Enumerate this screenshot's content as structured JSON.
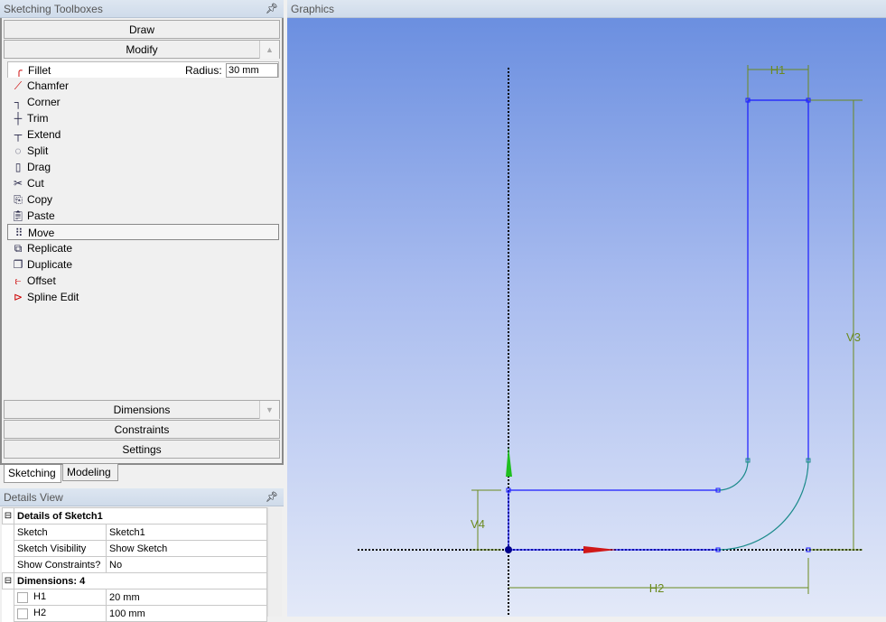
{
  "toolbox": {
    "title": "Sketching Toolboxes",
    "pin_icon": "pin-icon",
    "groups": {
      "draw": "Draw",
      "modify": "Modify",
      "dimensions": "Dimensions",
      "constraints": "Constraints",
      "settings": "Settings"
    },
    "radius_label": "Radius:",
    "radius_value": "30 mm",
    "tools": [
      {
        "label": "Fillet",
        "icon": "fillet-icon"
      },
      {
        "label": "Chamfer",
        "icon": "chamfer-icon"
      },
      {
        "label": "Corner",
        "icon": "corner-icon"
      },
      {
        "label": "Trim",
        "icon": "trim-icon"
      },
      {
        "label": "Extend",
        "icon": "extend-icon"
      },
      {
        "label": "Split",
        "icon": "split-icon"
      },
      {
        "label": "Drag",
        "icon": "drag-icon"
      },
      {
        "label": "Cut",
        "icon": "scissors-icon"
      },
      {
        "label": "Copy",
        "icon": "copy-icon"
      },
      {
        "label": "Paste",
        "icon": "paste-icon"
      },
      {
        "label": "Move",
        "icon": "move-icon"
      },
      {
        "label": "Replicate",
        "icon": "replicate-icon"
      },
      {
        "label": "Duplicate",
        "icon": "duplicate-icon"
      },
      {
        "label": "Offset",
        "icon": "offset-icon"
      },
      {
        "label": "Spline Edit",
        "icon": "spline-edit-icon"
      }
    ],
    "selected_tool": "Move",
    "tabs": [
      "Sketching",
      "Modeling"
    ],
    "active_tab": "Sketching"
  },
  "details": {
    "title": "Details View",
    "section1": "Details of Sketch1",
    "rows": [
      {
        "k": "Sketch",
        "v": "Sketch1"
      },
      {
        "k": "Sketch Visibility",
        "v": "Show Sketch"
      },
      {
        "k": "Show Constraints?",
        "v": "No"
      }
    ],
    "section2": "Dimensions: 4",
    "dims": [
      {
        "k": "H1",
        "v": "20 mm"
      },
      {
        "k": "H2",
        "v": "100 mm"
      }
    ]
  },
  "graphics": {
    "title": "Graphics",
    "dim_labels": {
      "h1": "H1",
      "h2": "H2",
      "v3": "V3",
      "v4": "V4"
    },
    "colors": {
      "sketch_line": "#1a1aff",
      "arc": "#1a8a8a",
      "dimension": "#6b8a1e"
    }
  }
}
